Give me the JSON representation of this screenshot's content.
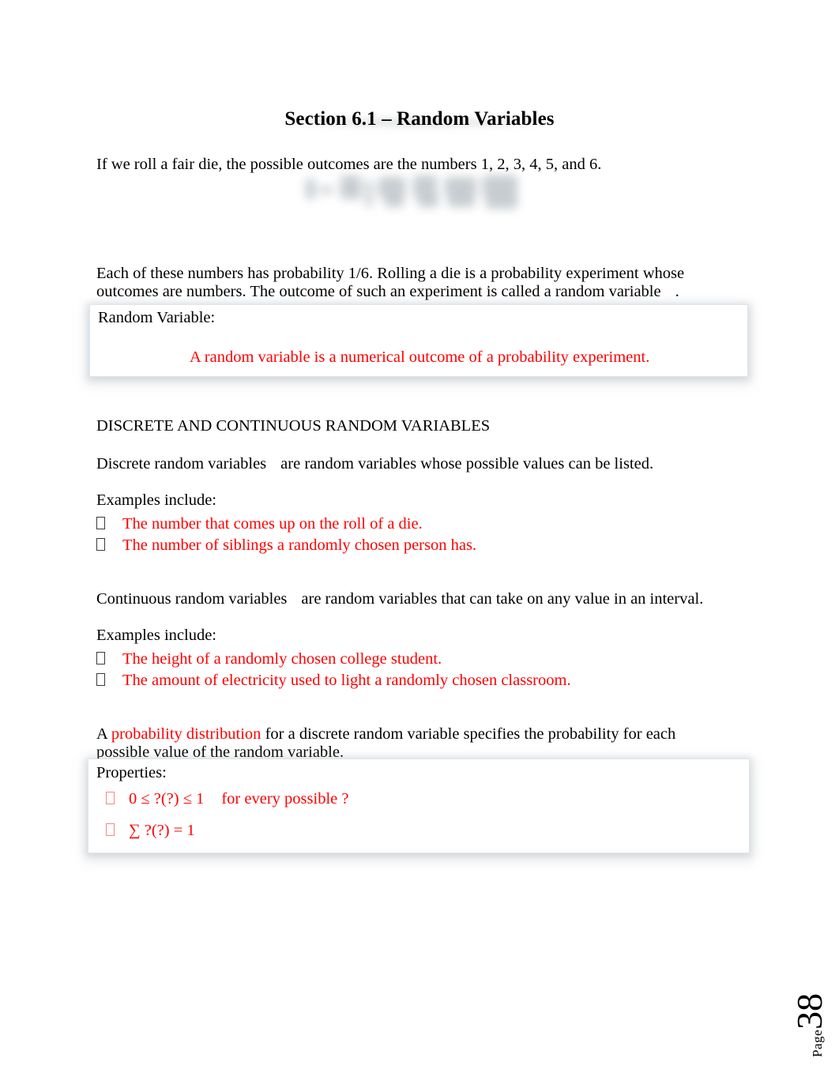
{
  "document": {
    "title": "Section 6.1 – Random Variables",
    "intro_paragraph": "If we roll a fair die, the possible outcomes are the numbers 1, 2, 3, 4, 5, and 6.",
    "figure_caption": "",
    "each_paragraph_line1": "Each of these numbers has probability 1/6. Rolling a die is a probability experiment whose",
    "each_paragraph_line2_a": "outcomes are numbers. The outcome of such an experiment is called a",
    "each_paragraph_line2_b": "random variable",
    "each_paragraph_line2_c": ".",
    "definition_box": {
      "label": "Random Variable:",
      "statement": "A random variable is a numerical outcome of a probability experiment."
    },
    "section_heading": "DISCRETE AND CONTINUOUS RANDOM VARIABLES",
    "discrete_term": "Discrete random variables",
    "discrete_definition": "are random variables whose possible values can be listed.",
    "examples_label_1": "Examples include:",
    "discrete_examples": [
      "The number that comes up on the roll of a die.",
      "The number of siblings a randomly chosen person has."
    ],
    "continuous_term": "Continuous random variables",
    "continuous_definition": "are random variables that can take on any value in an interval.",
    "examples_label_2": "Examples include:",
    "continuous_examples": [
      "The height of a randomly chosen college student.",
      "The amount of electricity used to light a randomly chosen classroom."
    ],
    "prob_dist_lead": "A",
    "prob_dist_term": "probability distribution",
    "prob_dist_rest_line1": "for a discrete random variable specifies the probability for each",
    "prob_dist_rest_line2": "possible value of the random variable.",
    "properties_box": {
      "label": "Properties:",
      "items": [
        {
          "formula": "0 ≤ ?(?) ≤ 1",
          "note": "for every possible ?"
        },
        {
          "formula": "∑ ?(?) = 1",
          "note": ""
        }
      ]
    },
    "footer": {
      "page_label": "Page",
      "page_value": "38"
    },
    "colors": {
      "accent_red": "#FF0000",
      "text_black": "#000000",
      "box_shadow_grey": "#969ea6"
    }
  }
}
